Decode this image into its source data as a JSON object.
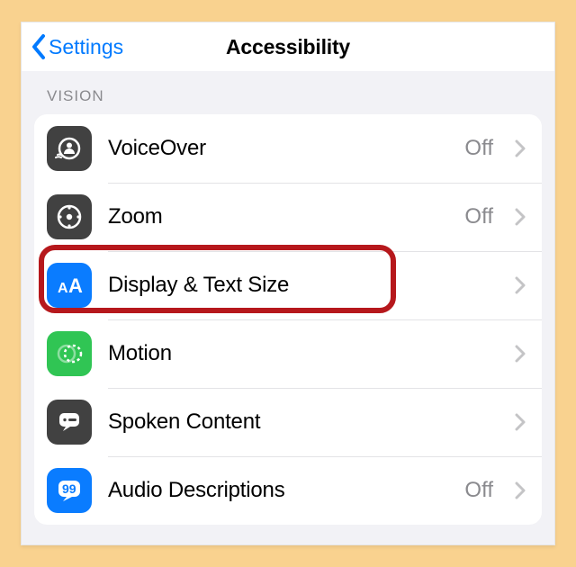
{
  "nav": {
    "back_label": "Settings",
    "title": "Accessibility"
  },
  "vision": {
    "header": "VISION",
    "items": [
      {
        "id": "voiceover",
        "label": "VoiceOver",
        "status": "Off"
      },
      {
        "id": "zoom",
        "label": "Zoom",
        "status": "Off"
      },
      {
        "id": "display-text-size",
        "label": "Display & Text Size",
        "status": ""
      },
      {
        "id": "motion",
        "label": "Motion",
        "status": ""
      },
      {
        "id": "spoken-content",
        "label": "Spoken Content",
        "status": ""
      },
      {
        "id": "audio-descriptions",
        "label": "Audio Descriptions",
        "status": "Off"
      }
    ]
  },
  "highlighted_item": "display-text-size"
}
